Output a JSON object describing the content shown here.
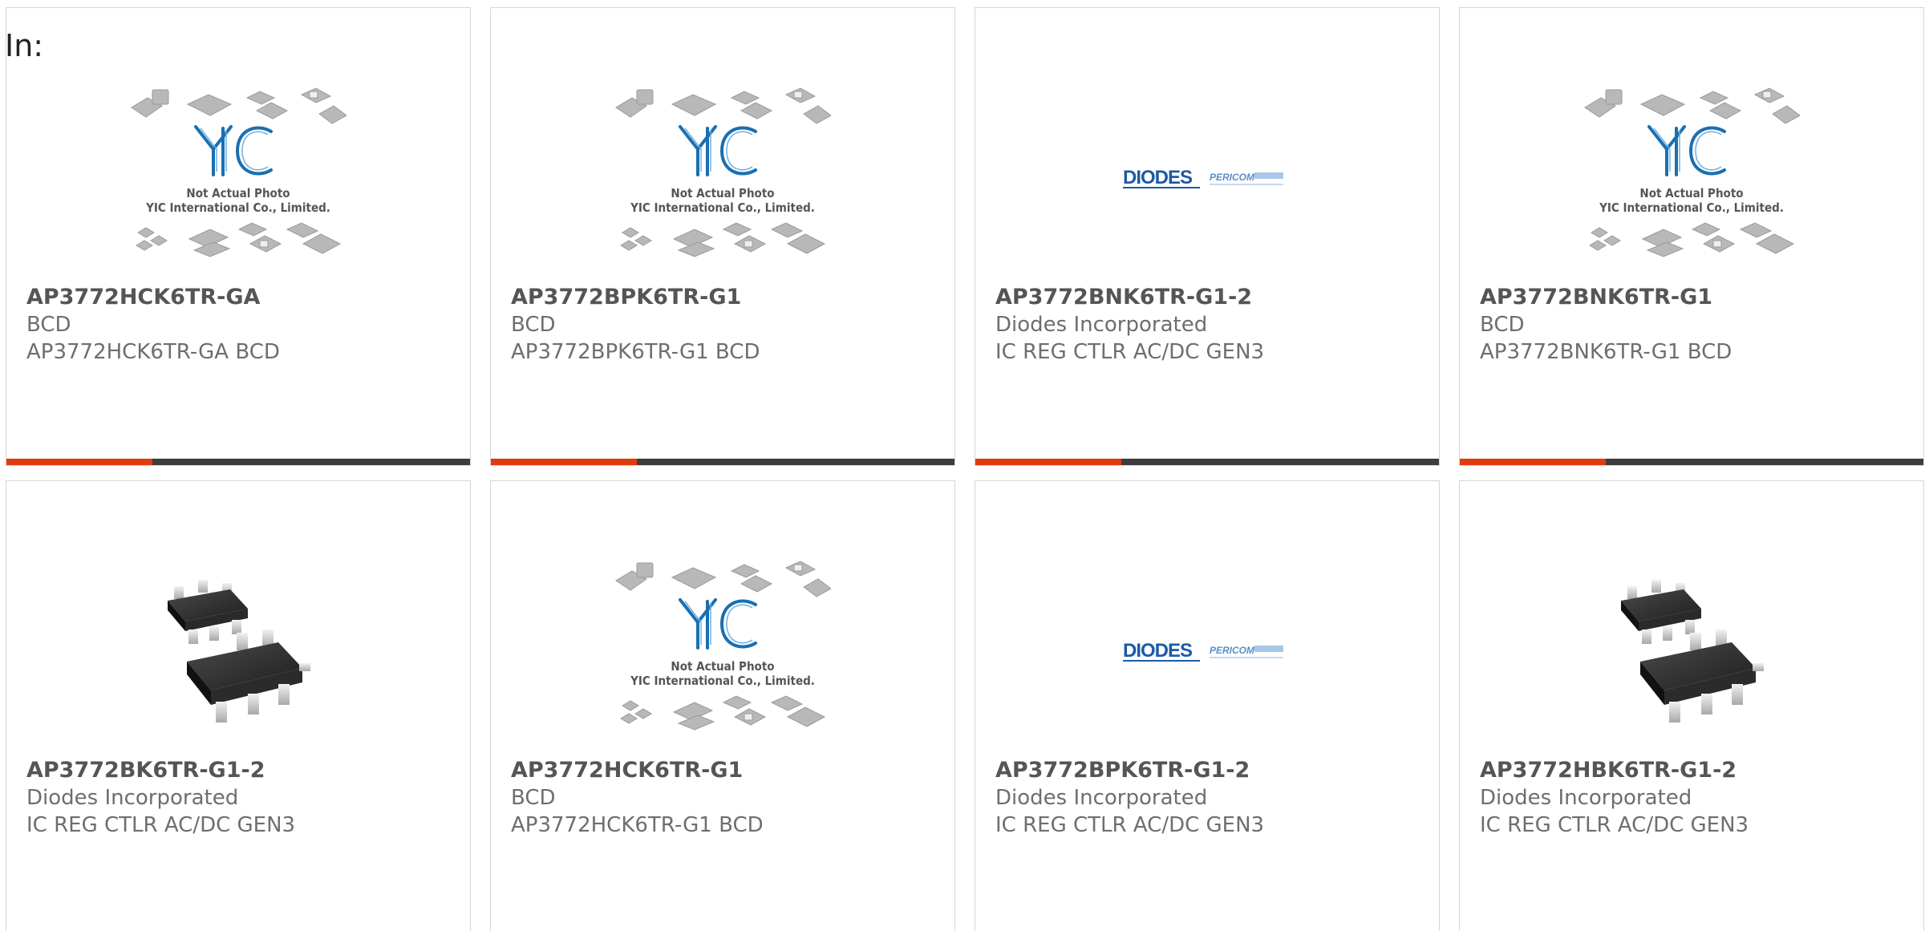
{
  "header": {
    "in_label": "In:"
  },
  "yic": {
    "logo": "YIC",
    "caption_1": "Not Actual Photo",
    "caption_2": "YIC International Co., Limited."
  },
  "diodes": {
    "logo": "DIODES",
    "sub": "PERICOM"
  },
  "colors": {
    "accent": "#e03a0f",
    "bar": "#3d3d3d",
    "yic_blue": "#1a6fb0",
    "diodes_blue": "#1d5aa6"
  },
  "products": [
    {
      "part_number": "AP3772HCK6TR-GA",
      "manufacturer": "BCD",
      "description": "AP3772HCK6TR-GA BCD",
      "image": "yic-placeholder"
    },
    {
      "part_number": "AP3772BPK6TR-G1",
      "manufacturer": "BCD",
      "description": "AP3772BPK6TR-G1 BCD",
      "image": "yic-placeholder"
    },
    {
      "part_number": "AP3772BNK6TR-G1-2",
      "manufacturer": "Diodes Incorporated",
      "description": "IC REG CTLR AC/DC GEN3",
      "image": "diodes-logo"
    },
    {
      "part_number": "AP3772BNK6TR-G1",
      "manufacturer": "BCD",
      "description": "AP3772BNK6TR-G1 BCD",
      "image": "yic-placeholder"
    },
    {
      "part_number": "AP3772BK6TR-G1-2",
      "manufacturer": "Diodes Incorporated",
      "description": "IC REG CTLR AC/DC GEN3",
      "image": "sot26-chip"
    },
    {
      "part_number": "AP3772HCK6TR-G1",
      "manufacturer": "BCD",
      "description": "AP3772HCK6TR-G1 BCD",
      "image": "yic-placeholder"
    },
    {
      "part_number": "AP3772BPK6TR-G1-2",
      "manufacturer": "Diodes Incorporated",
      "description": "IC REG CTLR AC/DC GEN3",
      "image": "diodes-logo"
    },
    {
      "part_number": "AP3772HBK6TR-G1-2",
      "manufacturer": "Diodes Incorporated",
      "description": "IC REG CTLR AC/DC GEN3",
      "image": "sot26-chip"
    }
  ]
}
